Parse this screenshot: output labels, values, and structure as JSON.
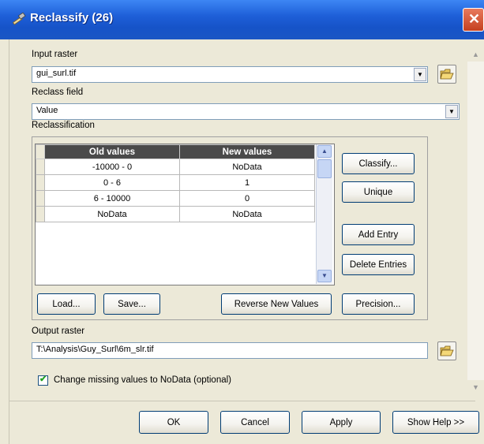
{
  "window": {
    "title": "Reclassify (26)",
    "titlebar_color": "#1e5fd8"
  },
  "input_raster": {
    "label": "Input raster",
    "value": "gui_surl.tif"
  },
  "reclass_field": {
    "label": "Reclass field",
    "value": "Value"
  },
  "reclassification": {
    "label": "Reclassification",
    "columns": [
      "Old values",
      "New values"
    ],
    "rows": [
      {
        "old": "-10000 - 0",
        "new": "NoData"
      },
      {
        "old": "0 - 6",
        "new": "1"
      },
      {
        "old": "6 - 10000",
        "new": "0"
      },
      {
        "old": "NoData",
        "new": "NoData"
      }
    ],
    "buttons": {
      "classify": "Classify...",
      "unique": "Unique",
      "add_entry": "Add Entry",
      "delete_entries": "Delete Entries",
      "load": "Load...",
      "save": "Save...",
      "reverse": "Reverse New Values",
      "precision": "Precision..."
    }
  },
  "output_raster": {
    "label": "Output raster",
    "value": "T:\\Analysis\\Guy_Surl\\6m_slr.tif"
  },
  "change_missing": {
    "label": "Change missing values to NoData (optional)",
    "checked": true
  },
  "footer": {
    "ok": "OK",
    "cancel": "Cancel",
    "apply": "Apply",
    "show_help": "Show Help >>"
  },
  "icons": {
    "title": "hammer-icon",
    "close": "close-icon",
    "folder": "open-folder-icon"
  }
}
